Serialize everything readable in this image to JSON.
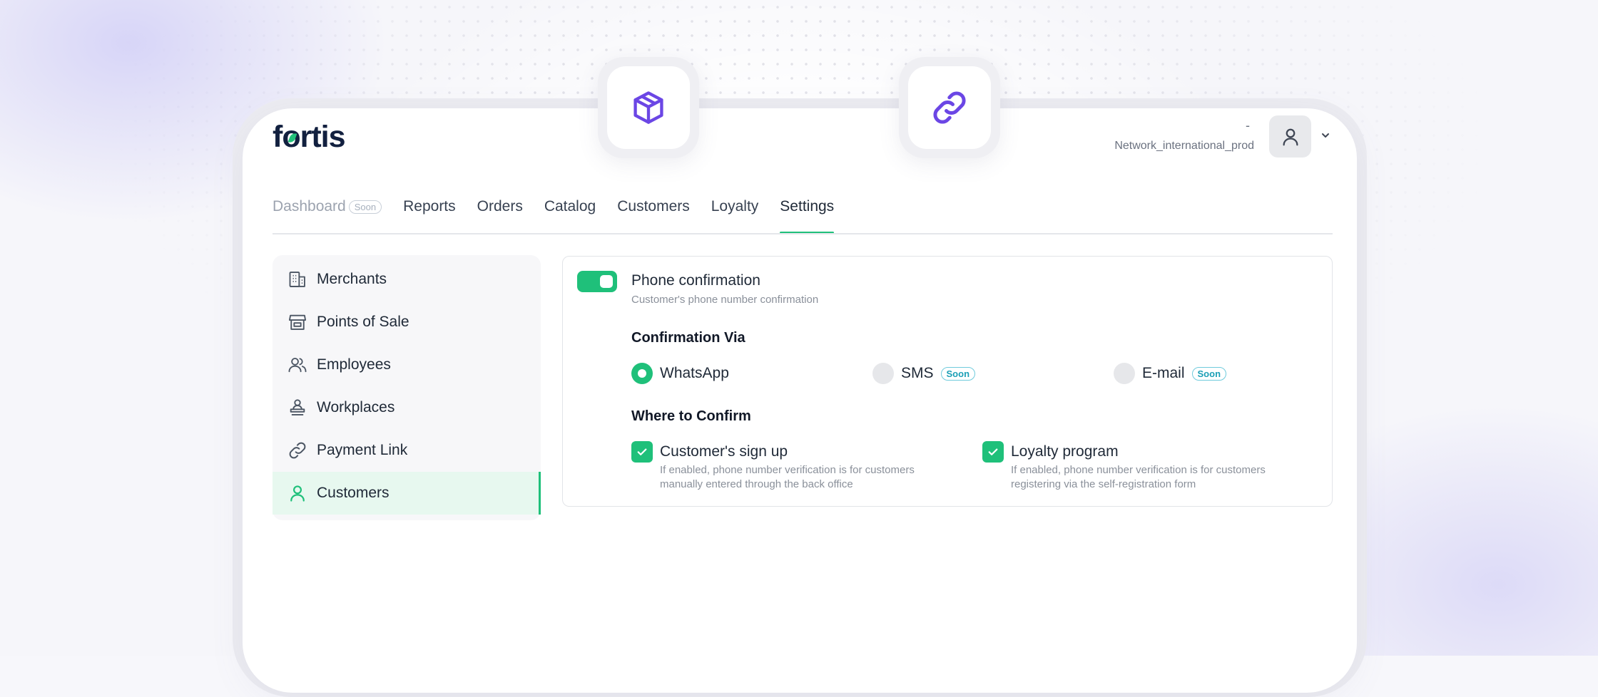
{
  "brand": {
    "logo_text_pre": "f",
    "logo_text_o": "o",
    "logo_text_post": "rtis"
  },
  "header": {
    "user_dash": "-",
    "user_name": "Network_international_prod"
  },
  "floating_icons": [
    "box-icon",
    "link-icon"
  ],
  "tabs": [
    {
      "label": "Dashboard",
      "badge": "Soon",
      "disabled": true
    },
    {
      "label": "Reports"
    },
    {
      "label": "Orders"
    },
    {
      "label": "Catalog"
    },
    {
      "label": "Customers"
    },
    {
      "label": "Loyalty"
    },
    {
      "label": "Settings",
      "active": true
    }
  ],
  "sidebar": {
    "items": [
      {
        "label": "Merchants",
        "icon": "building-icon"
      },
      {
        "label": "Points of Sale",
        "icon": "store-icon"
      },
      {
        "label": "Employees",
        "icon": "users-icon"
      },
      {
        "label": "Workplaces",
        "icon": "workplace-icon"
      },
      {
        "label": "Payment Link",
        "icon": "link-icon"
      },
      {
        "label": "Customers",
        "icon": "user-icon",
        "active": true
      }
    ]
  },
  "panel": {
    "toggle_on": true,
    "title": "Phone confirmation",
    "subtitle": "Customer's phone number confirmation",
    "via_heading": "Confirmation Via",
    "via_options": [
      {
        "label": "WhatsApp",
        "selected": true
      },
      {
        "label": "SMS",
        "badge": "Soon",
        "selected": false
      },
      {
        "label": "E-mail",
        "badge": "Soon",
        "selected": false
      }
    ],
    "where_heading": "Where to Confirm",
    "where_options": [
      {
        "label": "Customer's sign up",
        "checked": true,
        "desc": "If enabled, phone number verification is for customers manually entered through the back office"
      },
      {
        "label": "Loyalty program",
        "checked": true,
        "desc": "If enabled, phone number verification is for customers registering via the self-registration form"
      }
    ]
  },
  "colors": {
    "accent": "#1fc07a",
    "brand_dark": "#12203f",
    "icon_purple": "#6b46e5",
    "soon": "#1b9fb6"
  }
}
